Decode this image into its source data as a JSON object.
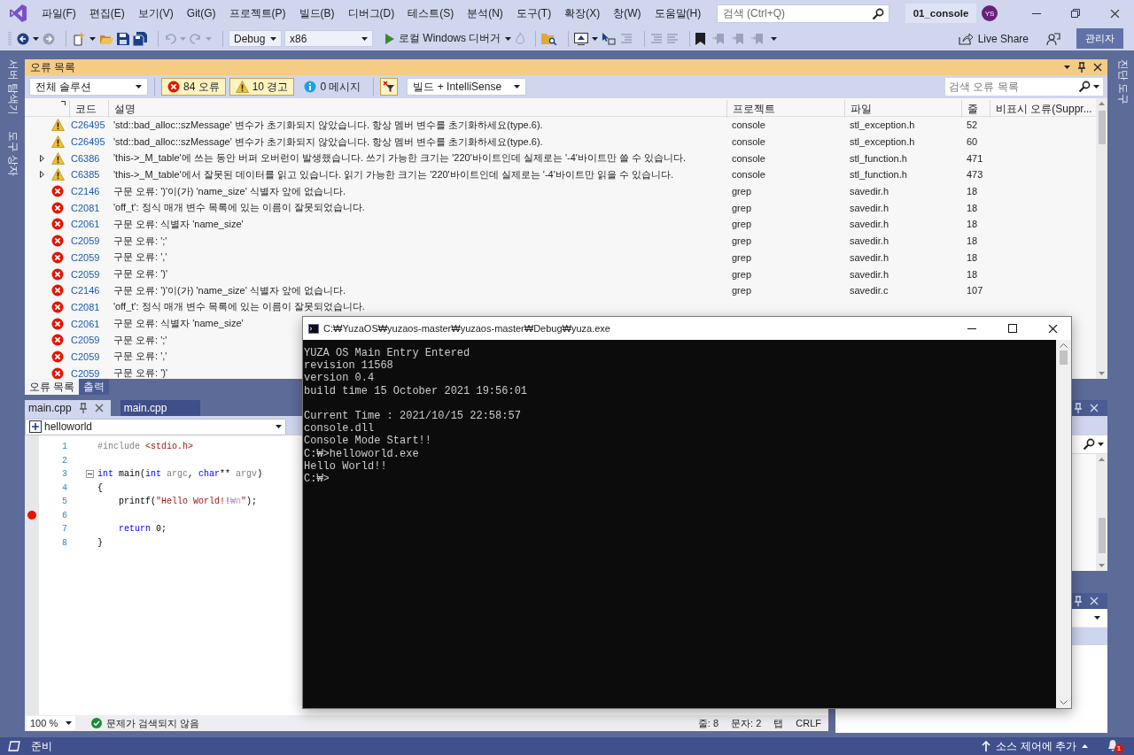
{
  "menu": [
    "파일(F)",
    "편집(E)",
    "보기(V)",
    "Git(G)",
    "프로젝트(P)",
    "빌드(B)",
    "디버그(D)",
    "테스트(S)",
    "분석(N)",
    "도구(T)",
    "확장(X)",
    "창(W)",
    "도움말(H)"
  ],
  "search": {
    "placeholder": "검색 (Ctrl+Q)"
  },
  "solution_name": "01_console",
  "account": {
    "initials": "YS"
  },
  "toolbar": {
    "configuration": "Debug",
    "platform": "x86",
    "debugger": "로컬 Windows 디버거",
    "live_share": "Live Share",
    "admin": "관리자"
  },
  "left_strip": [
    "서버 탐색기",
    "도구 상자"
  ],
  "right_strip": [
    "진단 도구"
  ],
  "error_list": {
    "title": "오류 목록",
    "scope": "전체 솔루션",
    "filters": [
      {
        "kind": "error",
        "label": "84 오류",
        "selected": true
      },
      {
        "kind": "warning",
        "label": "10 경고",
        "selected": true
      },
      {
        "kind": "info",
        "label": "0 메시지",
        "selected": false
      }
    ],
    "source": "빌드 + IntelliSense",
    "search": {
      "placeholder": "검색 오류 목록"
    },
    "columns": [
      "코드",
      "설명",
      "프로젝트",
      "파일",
      "줄",
      "비표시 오류(Suppr..."
    ],
    "rows": [
      {
        "kind": "warning",
        "expandable": false,
        "code": "C26495",
        "description": "'std::bad_alloc::szMessage' 변수가 초기화되지 않았습니다. 항상 멤버 변수를 초기화하세요(type.6).",
        "project": "console",
        "file": "stl_exception.h",
        "line": "52"
      },
      {
        "kind": "warning",
        "expandable": false,
        "code": "C26495",
        "description": "'std::bad_alloc::szMessage' 변수가 초기화되지 않았습니다. 항상 멤버 변수를 초기화하세요(type.6).",
        "project": "console",
        "file": "stl_exception.h",
        "line": "60"
      },
      {
        "kind": "warning",
        "expandable": true,
        "code": "C6386",
        "description": "'this->_M_table'에 쓰는 동안 버퍼 오버런이 발생했습니다.  쓰기 가능한 크기는 '220'바이트인데 실제로는 '-4'바이트만 쓸 수 있습니다.",
        "project": "console",
        "file": "stl_function.h",
        "line": "471"
      },
      {
        "kind": "warning",
        "expandable": true,
        "code": "C6385",
        "description": "'this->_M_table'에서 잘못된 데이터를 읽고 있습니다.  읽기 가능한 크기는 '220'바이트인데 실제로는 '-4'바이트만 읽을 수 있습니다.",
        "project": "console",
        "file": "stl_function.h",
        "line": "473"
      },
      {
        "kind": "error",
        "expandable": false,
        "code": "C2146",
        "description": "구문 오류: ')'이(가) 'name_size' 식별자 앞에 없습니다.",
        "project": "grep",
        "file": "savedir.h",
        "line": "18"
      },
      {
        "kind": "error",
        "expandable": false,
        "code": "C2081",
        "description": "'off_t': 정식 매개 변수 목록에 있는 이름이 잘못되었습니다.",
        "project": "grep",
        "file": "savedir.h",
        "line": "18"
      },
      {
        "kind": "error",
        "expandable": false,
        "code": "C2061",
        "description": "구문 오류: 식별자 'name_size'",
        "project": "grep",
        "file": "savedir.h",
        "line": "18"
      },
      {
        "kind": "error",
        "expandable": false,
        "code": "C2059",
        "description": "구문 오류: ';'",
        "project": "grep",
        "file": "savedir.h",
        "line": "18"
      },
      {
        "kind": "error",
        "expandable": false,
        "code": "C2059",
        "description": "구문 오류: ','",
        "project": "grep",
        "file": "savedir.h",
        "line": "18"
      },
      {
        "kind": "error",
        "expandable": false,
        "code": "C2059",
        "description": "구문 오류: ')'",
        "project": "grep",
        "file": "savedir.h",
        "line": "18"
      },
      {
        "kind": "error",
        "expandable": false,
        "code": "C2146",
        "description": "구문 오류: ')'이(가) 'name_size' 식별자 앞에 없습니다.",
        "project": "grep",
        "file": "savedir.c",
        "line": "107"
      },
      {
        "kind": "error",
        "expandable": false,
        "code": "C2081",
        "description": "'off_t': 정식 매개 변수 목록에 있는 이름이 잘못되었습니다."
      },
      {
        "kind": "error",
        "expandable": false,
        "code": "C2061",
        "description": "구문 오류: 식별자 'name_size'"
      },
      {
        "kind": "error",
        "expandable": false,
        "code": "C2059",
        "description": "구문 오류: ';'"
      },
      {
        "kind": "error",
        "expandable": false,
        "code": "C2059",
        "description": "구문 오류: ','"
      },
      {
        "kind": "error",
        "expandable": false,
        "code": "C2059",
        "description": "구문 오류: ')'"
      }
    ]
  },
  "output_tabs": [
    {
      "label": "오류 목록",
      "selected": true
    },
    {
      "label": "출력",
      "selected": false
    }
  ],
  "editor": {
    "tabs": [
      {
        "label": "main.cpp",
        "selected": true
      },
      {
        "label": "main.cpp",
        "selected": false
      }
    ],
    "scope": "helloworld",
    "lines": [
      {
        "number": "1",
        "breakpoint": false,
        "collapsible": false,
        "tokens": [
          {
            "kind": "preproc",
            "text": "#include"
          },
          {
            "kind": "string",
            "text": " <stdio.h>"
          }
        ]
      },
      {
        "number": "2",
        "breakpoint": false,
        "collapsible": false
      },
      {
        "number": "3",
        "breakpoint": false,
        "collapsible": true,
        "tokens": [
          {
            "kind": "keyword",
            "text": "int"
          },
          {
            "kind": "plain",
            "text": " main("
          },
          {
            "kind": "keyword",
            "text": "int"
          },
          {
            "kind": "param",
            "text": " argc"
          },
          {
            "kind": "plain",
            "text": ", "
          },
          {
            "kind": "keyword",
            "text": "char"
          },
          {
            "kind": "plain",
            "text": "** "
          },
          {
            "kind": "param",
            "text": "argv"
          },
          {
            "kind": "plain",
            "text": ")"
          }
        ]
      },
      {
        "number": "4",
        "breakpoint": false,
        "collapsible": false,
        "tokens": [
          {
            "kind": "plain",
            "text": "{"
          }
        ]
      },
      {
        "number": "5",
        "breakpoint": false,
        "collapsible": false,
        "tokens": [
          {
            "kind": "plain",
            "text": "    printf("
          },
          {
            "kind": "string",
            "text": "\"Hello World!!"
          },
          {
            "kind": "escape",
            "text": "₩n"
          },
          {
            "kind": "string",
            "text": "\""
          },
          {
            "kind": "plain",
            "text": ");"
          }
        ]
      },
      {
        "number": "6",
        "breakpoint": true,
        "collapsible": false
      },
      {
        "number": "7",
        "breakpoint": false,
        "collapsible": false,
        "tokens": [
          {
            "kind": "keyword",
            "text": "    return"
          },
          {
            "kind": "plain",
            "text": " 0;"
          }
        ]
      },
      {
        "number": "8",
        "breakpoint": false,
        "collapsible": false,
        "tokens": [
          {
            "kind": "plain",
            "text": "}"
          }
        ]
      }
    ],
    "zoom": "100 %",
    "issues": "문제가 검색되지 않음",
    "line": "줄: 8",
    "column": "문자: 2",
    "indent": "탭",
    "line_ending": "CRLF"
  },
  "console": {
    "title": "C:₩YuzaOS₩yuzaos-master₩yuzaos-master₩Debug₩yuza.exe",
    "lines": [
      {
        "kind": "text",
        "text": "YUZA OS Main Entry Entered"
      },
      {
        "kind": "text",
        "text": "revision 11568"
      },
      {
        "kind": "text",
        "text": "version 0.4"
      },
      {
        "kind": "text",
        "text": "build time 15 October 2021 19:56:01"
      },
      {
        "kind": "blank"
      },
      {
        "kind": "text",
        "text": "Current Time : 2021/10/15 22:58:57"
      },
      {
        "kind": "text",
        "text": "console.dll"
      },
      {
        "kind": "text",
        "text": "Console Mode Start!!"
      },
      {
        "kind": "text",
        "text": "C:₩>helloworld.exe"
      },
      {
        "kind": "text",
        "text": "Hello World!!"
      },
      {
        "kind": "text",
        "text": "C:₩>"
      }
    ]
  },
  "status_bar": {
    "state": "준비",
    "source_control": "소스 제어에 추가",
    "notifications": "1"
  }
}
